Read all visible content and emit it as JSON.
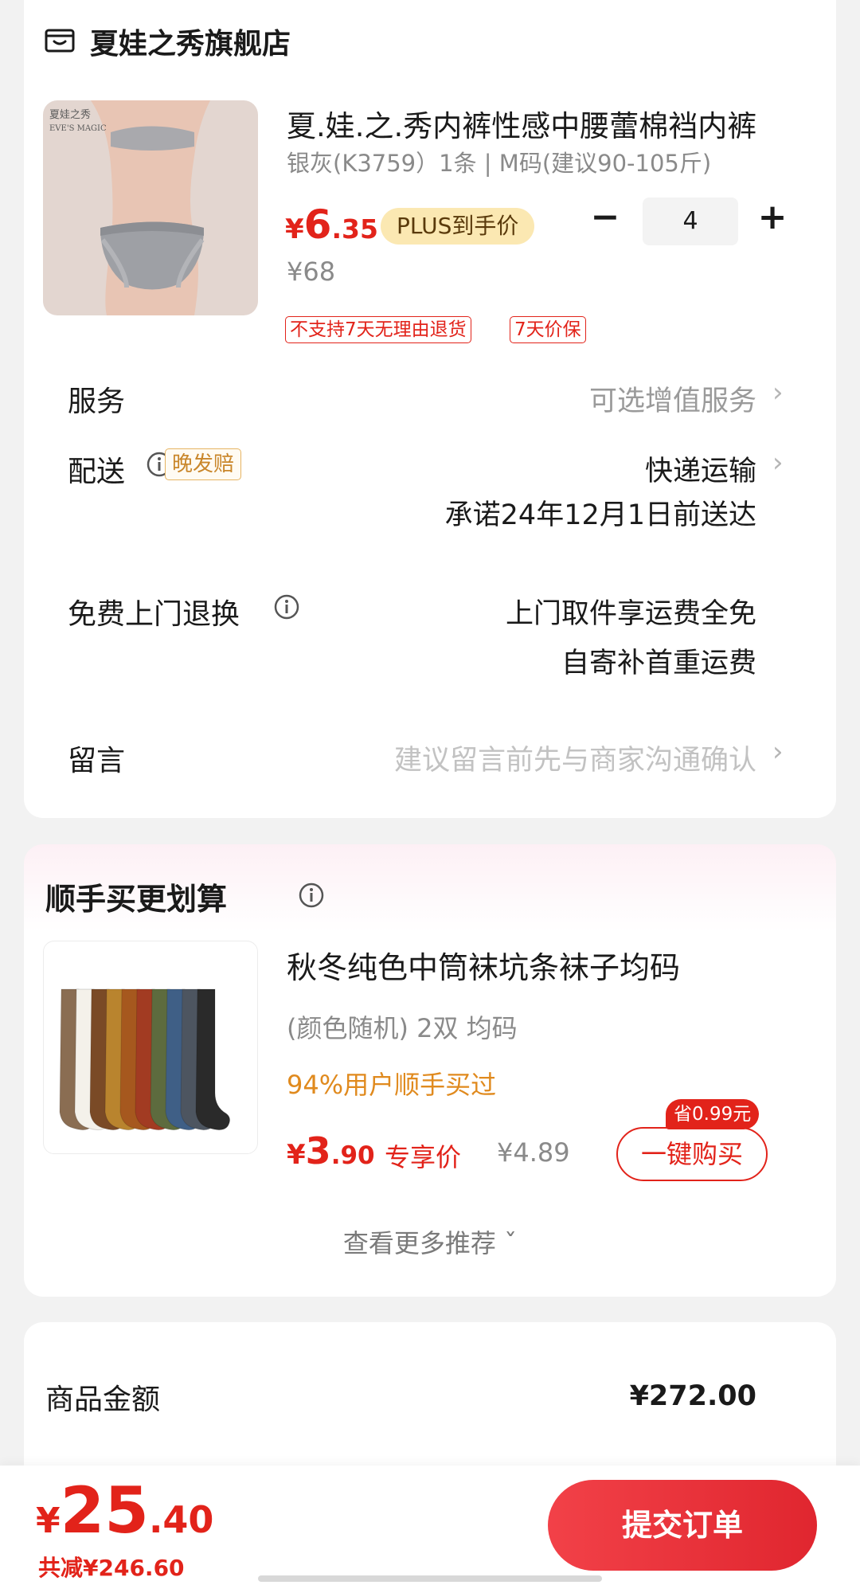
{
  "store": {
    "name": "夏娃之秀旗舰店",
    "icon": "store-icon"
  },
  "product": {
    "title": "夏.娃.之.秀内裤性感中腰蕾棉裆内裤",
    "spec": "银灰(K3759）1条 | M码(建议90-105斤)",
    "price_currency": "¥",
    "price_int": "6",
    "price_dec": ".35",
    "plus_label": "PLUS到手价",
    "original_price": "¥68",
    "quantity": "4",
    "minus_symbol": "−",
    "plus_symbol": "+",
    "tags": [
      "不支持7天无理由退货",
      "7天价保"
    ],
    "image_text": [
      "夏娃之秀",
      "EVE'S MAGIC"
    ]
  },
  "rows": {
    "service_label": "服务",
    "service_value": "可选增值服务",
    "delivery_label": "配送",
    "delivery_tag": "晚发赔",
    "delivery_value": "快递运输",
    "delivery_promise": "承诺24年12月1日前送达",
    "return_label": "免费上门退换",
    "return_line1": "上门取件享运费全免",
    "return_line2": "自寄补首重运费",
    "note_label": "留言",
    "note_placeholder": "建议留言前先与商家沟通确认",
    "chevron": "›"
  },
  "recommend": {
    "title": "顺手买更划算",
    "name": "秋冬纯色中筒袜坑条袜子均码",
    "spec": "(颜色随机) 2双   均码",
    "rate": "94%用户顺手买过",
    "price_currency": "¥",
    "price_int": "3",
    "price_dec": ".90",
    "exclusive_label": "专享价",
    "old_price": "¥4.89",
    "save_badge": "省0.99元",
    "buy_label": "一键购买",
    "more_label": "查看更多推荐 ˇ",
    "sock_colors": [
      "#8a6d52",
      "#f4f1ea",
      "#7a4a26",
      "#b9842e",
      "#a6581e",
      "#a23b22",
      "#5d6b3e",
      "#3f5f86",
      "#4d5560",
      "#2a2a2a"
    ]
  },
  "summary": {
    "label": "商品金额",
    "value": "¥272.00"
  },
  "bottom": {
    "currency": "¥",
    "total_int": "25",
    "total_dec": ".40",
    "discount": "共减¥246.60",
    "submit_label": "提交订单"
  },
  "colors": {
    "accent": "#e2231a",
    "plus_bg": "#fbe8b2",
    "late_tag": "#c9862a",
    "rate": "#e08a1e"
  }
}
